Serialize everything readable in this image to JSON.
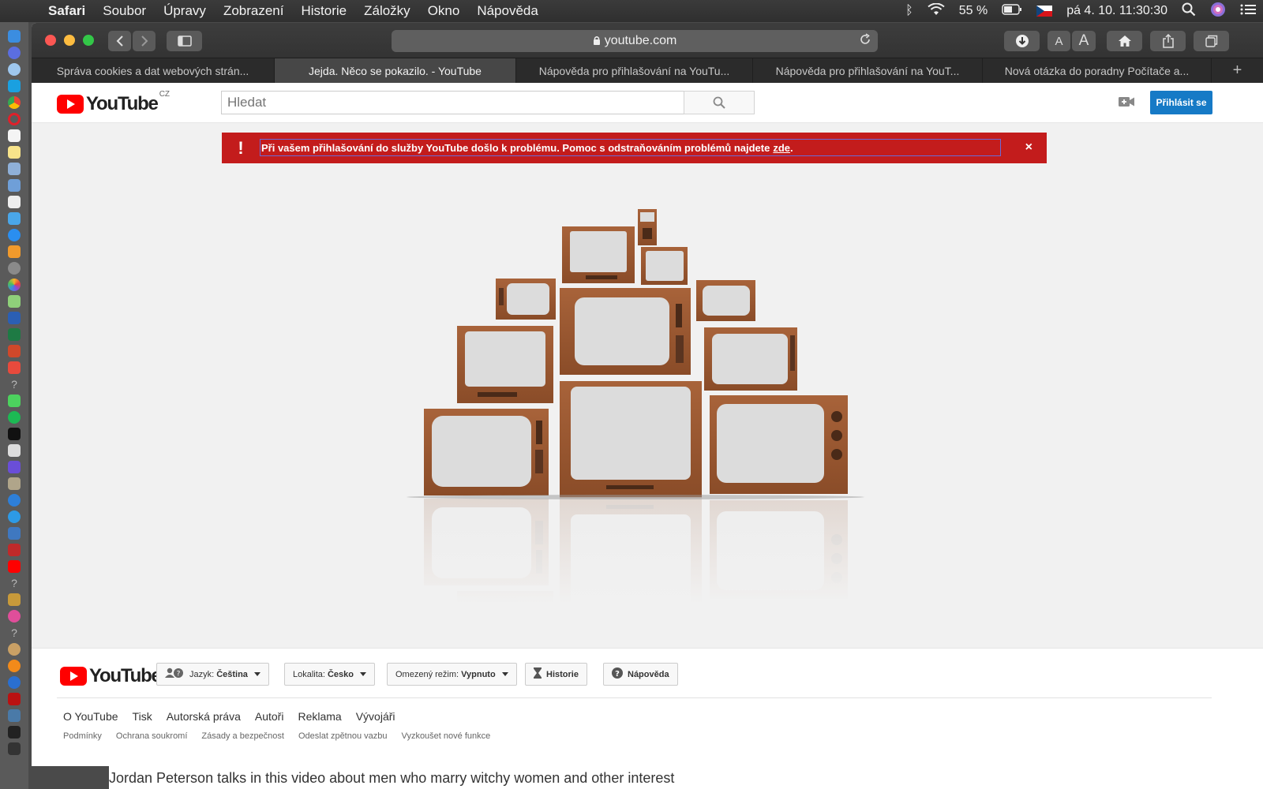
{
  "menubar": {
    "app": "Safari",
    "items": [
      "Soubor",
      "Úpravy",
      "Zobrazení",
      "Historie",
      "Záložky",
      "Okno",
      "Nápověda"
    ],
    "battery": "55 %",
    "datetime": "pá 4. 10.  11:30:30"
  },
  "browser": {
    "url": "youtube.com",
    "tabs": [
      {
        "label": "Správa cookies a dat webových strán..."
      },
      {
        "label": "Jejda. Něco se pokazilo. - YouTube"
      },
      {
        "label": "Nápověda pro přihlašování na YouTu..."
      },
      {
        "label": "Nápověda pro přihlašování na YouT..."
      },
      {
        "label": "Nová otázka do poradny Počítače a..."
      }
    ],
    "font_small": "A",
    "font_large": "A",
    "new_tab": "+"
  },
  "youtube": {
    "logo_text": "YouTube",
    "country_code": "CZ",
    "search_placeholder": "Hledat",
    "signin_label": "Přihlásit se",
    "alert": {
      "message": "Při vašem přihlašování do služby YouTube došlo k problému. Pomoc s odstraňováním problémů najdete",
      "link": "zde",
      "period": ".",
      "close": "×",
      "color": "#c31c1c"
    },
    "footer": {
      "logo_text": "YouTube",
      "language_prefix": "Jazyk:",
      "language_value": "Čeština",
      "location_prefix": "Lokalita:",
      "location_value": "Česko",
      "restricted_prefix": "Omezený režim:",
      "restricted_value": "Vypnuto",
      "history": "Historie",
      "help": "Nápověda",
      "links_primary": [
        "O YouTube",
        "Tisk",
        "Autorská práva",
        "Autoři",
        "Reklama",
        "Vývojáři"
      ],
      "links_secondary": [
        "Podmínky",
        "Ochrana soukromí",
        "Zásady a bezpečnost",
        "Odeslat zpětnou vazbu",
        "Vyzkoušet nové funkce"
      ]
    }
  },
  "background_text": "Jordan Peterson talks in this video about men who marry witchy women and other interest"
}
